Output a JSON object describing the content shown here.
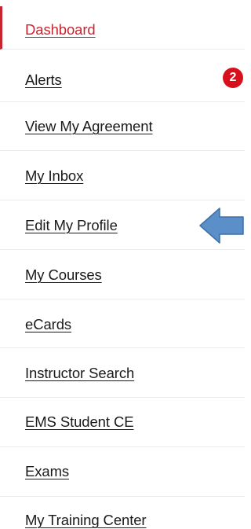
{
  "nav": {
    "items": [
      {
        "label": "Dashboard",
        "active": true
      },
      {
        "label": "Alerts",
        "badge": "2"
      },
      {
        "label": "View My Agreement"
      },
      {
        "label": "My Inbox"
      },
      {
        "label": "Edit My Profile"
      },
      {
        "label": "My Courses"
      },
      {
        "label": "eCards"
      },
      {
        "label": "Instructor Search"
      },
      {
        "label": "EMS Student CE"
      },
      {
        "label": "Exams"
      },
      {
        "label": "My Training Center"
      }
    ]
  },
  "annotation": {
    "arrow_icon": "left-arrow-icon",
    "arrow_color": "#5b8fc9",
    "points_to": "Edit My Profile"
  },
  "colors": {
    "active_accent": "#c9252f",
    "badge": "#d7101c",
    "text": "#1a1a1a"
  }
}
